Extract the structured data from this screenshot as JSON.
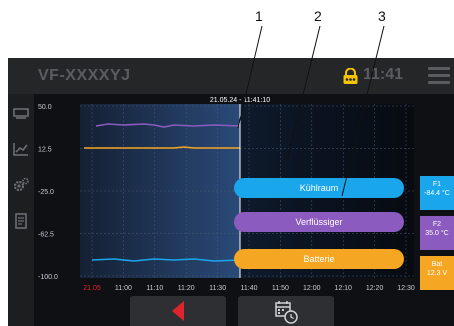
{
  "callouts": [
    "1",
    "2",
    "3"
  ],
  "header": {
    "device_id": "VF-XXXXYJ",
    "time": "11:41",
    "lock_icon": "lock-icon",
    "menu_icon": "menu-icon",
    "accent": "#f5c400"
  },
  "sidebar": {
    "items": [
      {
        "icon": "device-icon"
      },
      {
        "icon": "chart-icon"
      },
      {
        "icon": "settings-icon"
      },
      {
        "icon": "report-icon"
      }
    ]
  },
  "chart": {
    "cursor_label": "21.05.24 - 11:41:10",
    "y_ticks": [
      "50.0",
      "12.5",
      "-25.0",
      "-62.5",
      "-100.0"
    ],
    "x_ticks": [
      "21.05",
      "11:00",
      "11:10",
      "11:20",
      "11:30",
      "11:40",
      "11:50",
      "12:00",
      "12:10",
      "12:20",
      "12:30"
    ],
    "x_first_color": "#e0242b",
    "series_colors": {
      "kuehlraum": "#1aa6ea",
      "verfluessiger": "#8b5bbf",
      "batterie": "#f5a623"
    }
  },
  "legend": {
    "kuehlraum": "Kühlraum",
    "verfluessiger": "Verflüssiger",
    "batterie": "Batterie"
  },
  "side_cards": [
    {
      "line1": "F1",
      "line2": "-84.4 °C",
      "color": "#1aa6ea"
    },
    {
      "line1": "F2",
      "line2": "35.0 °C",
      "color": "#8b5bbf"
    },
    {
      "line1": "Bat",
      "line2": "12.3 V",
      "color": "#f5a623"
    }
  ],
  "bottom": {
    "back_icon": "back-arrow-icon",
    "calendar_icon": "calendar-clock-icon",
    "back_color": "#e0242b"
  }
}
